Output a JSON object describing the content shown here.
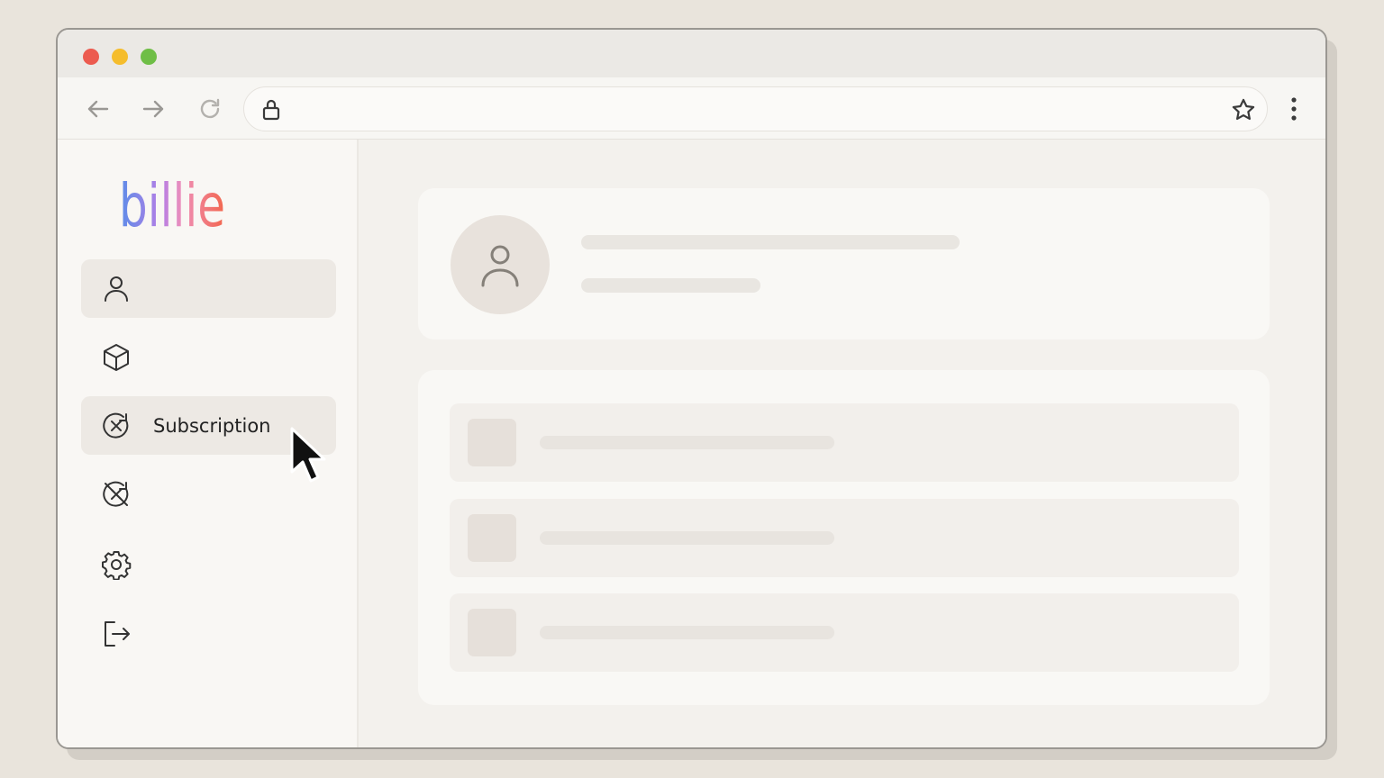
{
  "window": {
    "traffic_lights": [
      "close",
      "minimize",
      "maximize"
    ],
    "colors": {
      "close": "#ec5b4f",
      "minimize": "#f5bd2c",
      "maximize": "#6fbe46"
    }
  },
  "toolbar": {
    "back_icon": "arrow-left-icon",
    "forward_icon": "arrow-right-icon",
    "reload_icon": "reload-icon",
    "address_icon": "lock-icon",
    "bookmark_icon": "star-icon",
    "menu_icon": "kebab-menu-icon"
  },
  "brand": {
    "logo_text": "billie",
    "colors": [
      "#5b8de8",
      "#b57ee6",
      "#f08fb8",
      "#f2664c"
    ]
  },
  "sidebar": {
    "items": [
      {
        "icon": "user-icon",
        "label": "",
        "highlighted": true
      },
      {
        "icon": "box-icon",
        "label": ""
      },
      {
        "icon": "subscription-icon",
        "label": "Subscription",
        "highlighted": true
      },
      {
        "icon": "cancel-subscription-icon",
        "label": ""
      },
      {
        "icon": "gear-icon",
        "label": ""
      },
      {
        "icon": "logout-icon",
        "label": ""
      }
    ]
  },
  "main": {
    "profile": {
      "avatar_icon": "user-icon"
    },
    "list": {
      "row_count": 3
    }
  }
}
